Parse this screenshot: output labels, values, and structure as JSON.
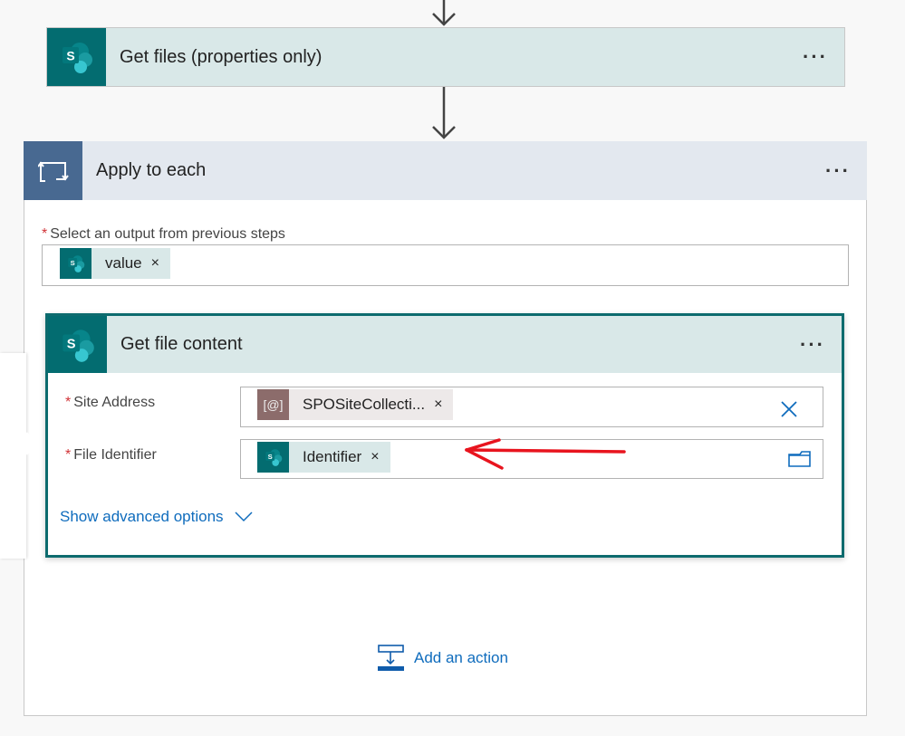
{
  "steps": {
    "get_files": {
      "title": "Get files (properties only)",
      "more": "···"
    },
    "apply_each": {
      "title": "Apply to each",
      "more": "···",
      "output_label": "Select an output from previous steps",
      "output_token": "value",
      "get_content": {
        "title": "Get file content",
        "more": "···",
        "site_address_label": "Site Address",
        "site_address_token": "SPOSiteCollecti...",
        "site_address_token_icon": "[@]",
        "file_identifier_label": "File Identifier",
        "file_identifier_token": "Identifier",
        "advanced": "Show advanced options"
      },
      "add_action": "Add an action"
    }
  },
  "required_mark": "*",
  "remove_mark": "×",
  "sp_letter": "S",
  "colors": {
    "sharepoint": "#036c70",
    "loop": "#486991",
    "variable": "#8c6c6b",
    "link": "#0f6cbd",
    "annotation": "#e8141e"
  }
}
